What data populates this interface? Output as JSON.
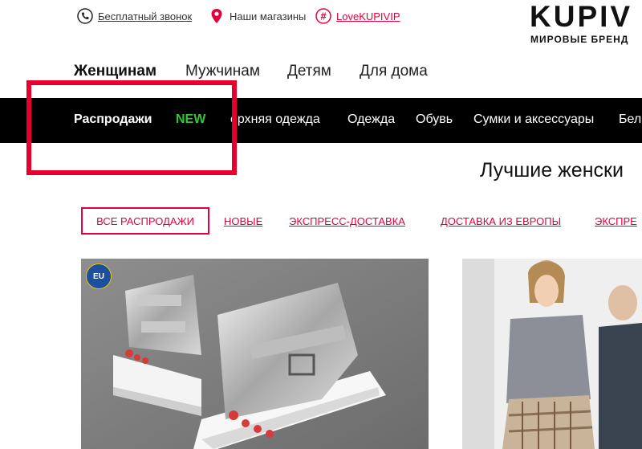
{
  "utility_bar": {
    "call_label": "Бесплатный звонок",
    "stores_label": "Наши магазины",
    "hashtag_label": "LoveKUPIVIP"
  },
  "logo": {
    "name": "KUPIV",
    "tagline": "МИРОВЫЕ БРЕНД"
  },
  "gender_nav": [
    {
      "label": "Женщинам",
      "active": true
    },
    {
      "label": "Мужчинам",
      "active": false
    },
    {
      "label": "Детям",
      "active": false
    },
    {
      "label": "Для дома",
      "active": false
    }
  ],
  "category_bar": {
    "items": [
      {
        "label": "Распродажи"
      },
      {
        "label": "NEW"
      },
      {
        "label": "ерхняя одежда"
      },
      {
        "label": "Одежда"
      },
      {
        "label": "Обувь"
      },
      {
        "label": "Сумки и аксессуары"
      },
      {
        "label": "Бел"
      }
    ]
  },
  "heading": "Лучшие женски",
  "filters": {
    "active": "ВСЕ РАСПРОДАЖИ",
    "items": [
      {
        "label": "НОВЫЕ"
      },
      {
        "label": "ЭКСПРЕСС-ДОСТАВКА"
      },
      {
        "label": "ДОСТАВКА ИЗ ЕВРОПЫ"
      },
      {
        "label": "ЭКСПРЕ"
      }
    ]
  },
  "cards": {
    "eu_badge": "EU"
  },
  "colors": {
    "accent": "#e5003d",
    "new_green": "#37c437",
    "bar": "#000000"
  }
}
